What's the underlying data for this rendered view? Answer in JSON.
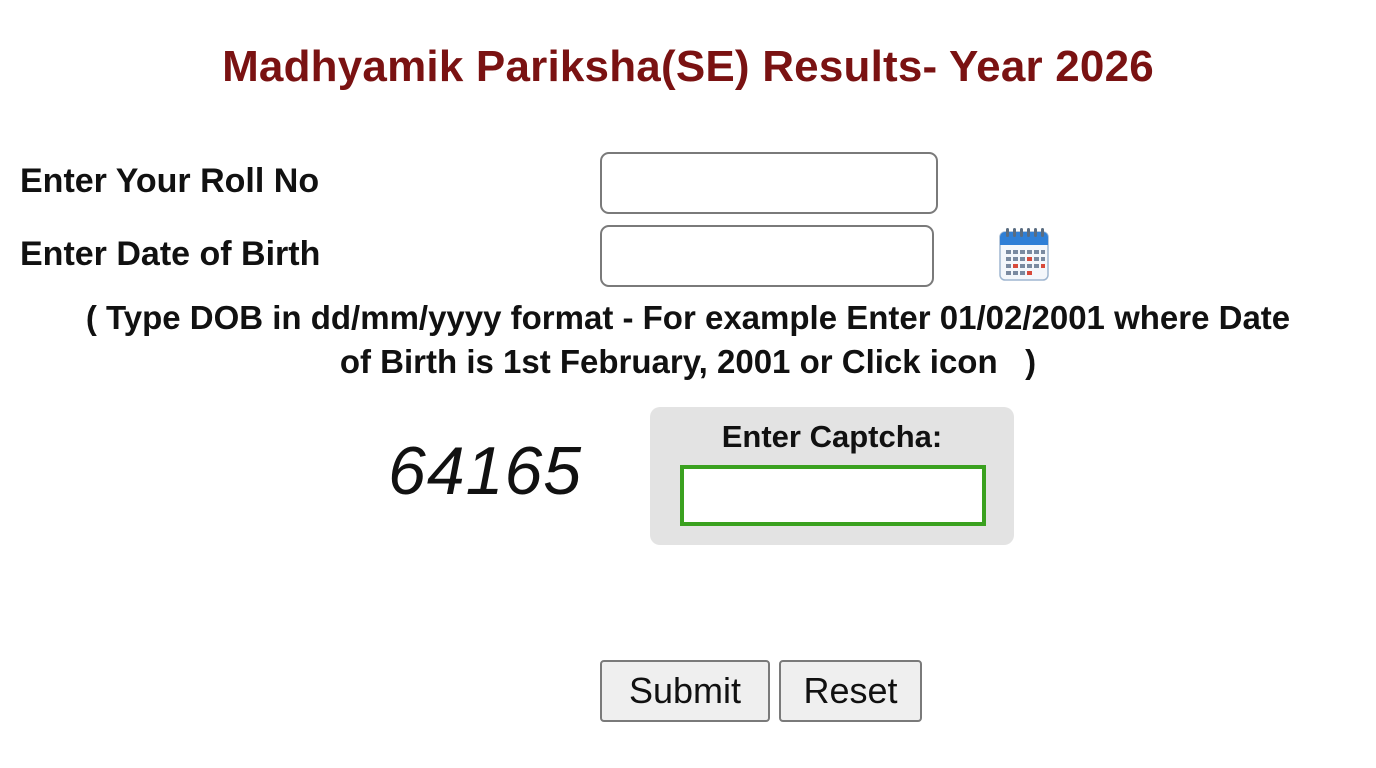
{
  "title": "Madhyamik Pariksha(SE) Results- Year 2026",
  "form": {
    "roll_label": "Enter Your Roll No",
    "roll_value": "",
    "dob_label": "Enter Date of Birth",
    "dob_value": "",
    "calendar_icon": "calendar-icon",
    "hint_line1": "( Type DOB in dd/mm/yyyy format - For example Enter 01/02/2001 where Date",
    "hint_line2": "of Birth is 1st February, 2001 or Click icon   )"
  },
  "captcha": {
    "code": "64165",
    "label": "Enter Captcha:",
    "value": ""
  },
  "buttons": {
    "submit": "Submit",
    "reset": "Reset"
  },
  "colors": {
    "title": "#7a1212",
    "captcha_border": "#3aa11f",
    "captcha_panel": "#e3e3e3",
    "calendar_header": "#2f7fd6",
    "calendar_dots_red": "#d84a3a"
  }
}
